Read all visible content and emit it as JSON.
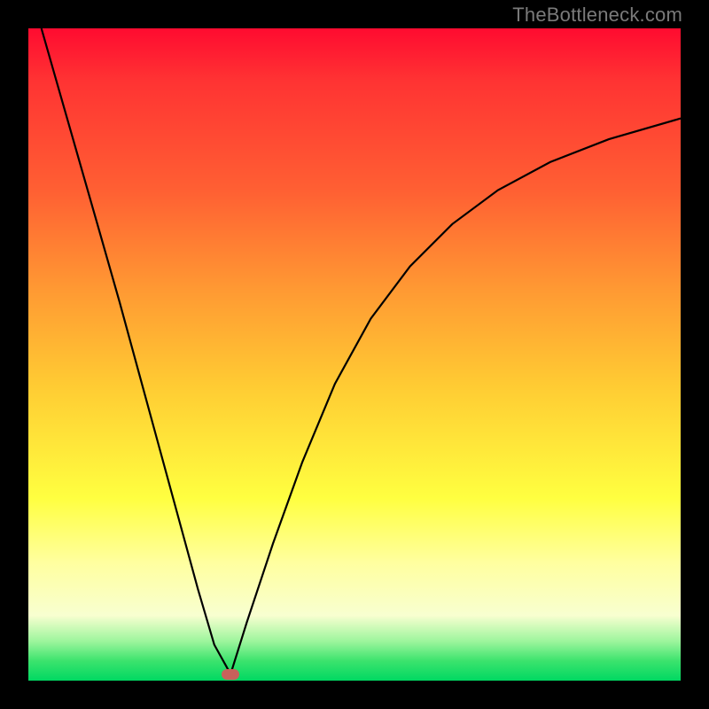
{
  "watermark": {
    "text": "TheBottleneck.com"
  },
  "chart_data": {
    "type": "line",
    "title": "",
    "xlabel": "",
    "ylabel": "",
    "xlim": [
      0,
      1
    ],
    "ylim": [
      0,
      1
    ],
    "grid": false,
    "legend": false,
    "background_gradient": {
      "direction": "vertical",
      "stops": [
        {
          "pos": 0.0,
          "color": "#ff0b30"
        },
        {
          "pos": 0.25,
          "color": "#ff6033"
        },
        {
          "pos": 0.55,
          "color": "#ffcc33"
        },
        {
          "pos": 0.8,
          "color": "#ffff80"
        },
        {
          "pos": 0.95,
          "color": "#60e080"
        },
        {
          "pos": 1.0,
          "color": "#00d862"
        }
      ]
    },
    "series": [
      {
        "name": "left-branch",
        "color": "#000000",
        "x": [
          0.02,
          0.05,
          0.08,
          0.11,
          0.14,
          0.17,
          0.2,
          0.23,
          0.26,
          0.285,
          0.31
        ],
        "y": [
          1.0,
          0.895,
          0.79,
          0.685,
          0.58,
          0.47,
          0.36,
          0.25,
          0.14,
          0.055,
          0.01
        ]
      },
      {
        "name": "right-branch",
        "color": "#000000",
        "x": [
          0.31,
          0.335,
          0.375,
          0.42,
          0.47,
          0.525,
          0.585,
          0.65,
          0.72,
          0.8,
          0.89,
          1.0
        ],
        "y": [
          0.01,
          0.09,
          0.21,
          0.335,
          0.455,
          0.555,
          0.635,
          0.7,
          0.752,
          0.795,
          0.83,
          0.862
        ]
      }
    ],
    "marker": {
      "x": 0.31,
      "y": 0.01,
      "color": "#c9615b",
      "shape": "rounded-rect"
    }
  }
}
